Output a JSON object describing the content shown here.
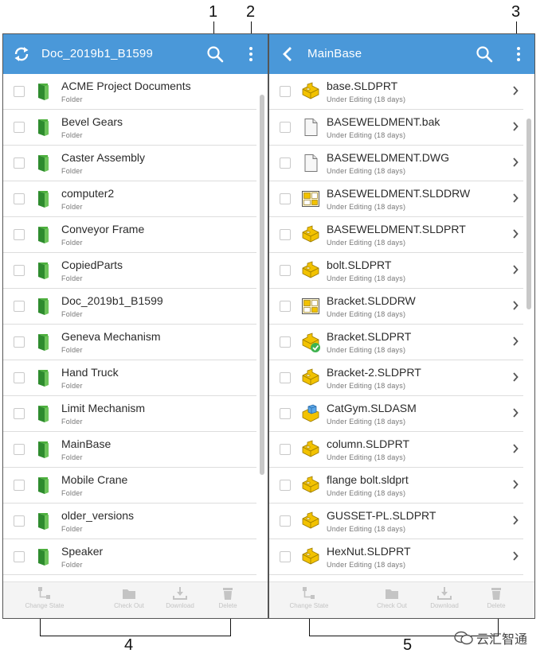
{
  "callouts": {
    "c1": "1",
    "c2": "2",
    "c3": "3",
    "c4": "4",
    "c5": "5"
  },
  "left_panel": {
    "title": "Doc_2019b1_B1599",
    "items": [
      {
        "name": "ACME Project Documents",
        "type": "Folder"
      },
      {
        "name": "Bevel Gears",
        "type": "Folder"
      },
      {
        "name": "Caster Assembly",
        "type": "Folder"
      },
      {
        "name": "computer2",
        "type": "Folder"
      },
      {
        "name": "Conveyor Frame",
        "type": "Folder"
      },
      {
        "name": "CopiedParts",
        "type": "Folder"
      },
      {
        "name": "Doc_2019b1_B1599",
        "type": "Folder"
      },
      {
        "name": "Geneva Mechanism",
        "type": "Folder"
      },
      {
        "name": "Hand Truck",
        "type": "Folder"
      },
      {
        "name": "Limit Mechanism",
        "type": "Folder"
      },
      {
        "name": "MainBase",
        "type": "Folder"
      },
      {
        "name": "Mobile Crane",
        "type": "Folder"
      },
      {
        "name": "older_versions",
        "type": "Folder"
      },
      {
        "name": "Speaker",
        "type": "Folder"
      }
    ],
    "toolbar": {
      "change_state": "Change State",
      "check_out": "Check Out",
      "download": "Download",
      "delete": "Delete"
    }
  },
  "right_panel": {
    "title": "MainBase",
    "items": [
      {
        "name": "base.SLDPRT",
        "status": "Under Editing (18 days)",
        "icon": "part-icon"
      },
      {
        "name": "BASEWELDMENT.bak",
        "status": "Under Editing (18 days)",
        "icon": "document-icon"
      },
      {
        "name": "BASEWELDMENT.DWG",
        "status": "Under Editing (18 days)",
        "icon": "document-icon"
      },
      {
        "name": "BASEWELDMENT.SLDDRW",
        "status": "Under Editing (18 days)",
        "icon": "drawing-icon"
      },
      {
        "name": "BASEWELDMENT.SLDPRT",
        "status": "Under Editing (18 days)",
        "icon": "part-icon"
      },
      {
        "name": "bolt.SLDPRT",
        "status": "Under Editing (18 days)",
        "icon": "part-icon"
      },
      {
        "name": "Bracket.SLDDRW",
        "status": "Under Editing (18 days)",
        "icon": "drawing-icon"
      },
      {
        "name": "Bracket.SLDPRT",
        "status": "Under Editing (18 days)",
        "icon": "part-checked-icon"
      },
      {
        "name": "Bracket-2.SLDPRT",
        "status": "Under Editing (18 days)",
        "icon": "part-icon"
      },
      {
        "name": "CatGym.SLDASM",
        "status": "Under Editing (18 days)",
        "icon": "assembly-icon"
      },
      {
        "name": "column.SLDPRT",
        "status": "Under Editing (18 days)",
        "icon": "part-icon"
      },
      {
        "name": "flange bolt.sldprt",
        "status": "Under Editing (18 days)",
        "icon": "part-icon"
      },
      {
        "name": "GUSSET-PL.SLDPRT",
        "status": "Under Editing (18 days)",
        "icon": "part-icon"
      },
      {
        "name": "HexNut.SLDPRT",
        "status": "Under Editing (18 days)",
        "icon": "part-icon"
      }
    ],
    "toolbar": {
      "change_state": "Change State",
      "check_out": "Check Out",
      "download": "Download",
      "delete": "Delete"
    }
  },
  "watermark": "云汇智通",
  "colors": {
    "header": "#4a98d9",
    "folder_green": "#3a9a3a",
    "part_yellow": "#f2c200",
    "check_green": "#3fb24f"
  }
}
